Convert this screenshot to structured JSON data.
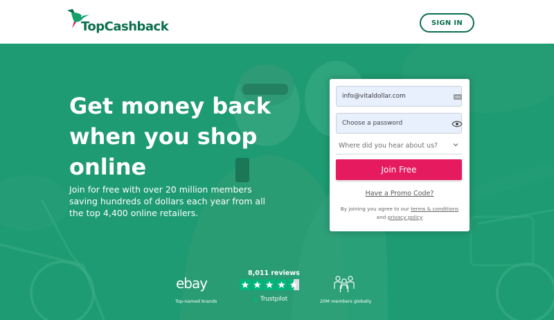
{
  "header": {
    "brand": "TopCashback",
    "signin_label": "SIGN IN"
  },
  "hero": {
    "headline": "Get money back when you shop online",
    "subtext": "Join for free with over 20 million members saving hundreds of dollars each year from all the top 4,400 online retailers."
  },
  "form": {
    "email_value": "info@vitaldollar.com",
    "password_placeholder": "Choose a password",
    "source_placeholder": "Where did you hear about us?",
    "join_label": "Join Free",
    "promo_label": "Have a Promo Code?",
    "terms_prefix": "By joining you agree to our ",
    "terms_link": "terms & conditions",
    "terms_and": " and ",
    "privacy_link": "privacy policy"
  },
  "trust": {
    "ebay_logo": "ebay",
    "ebay_caption": "Top-named brands",
    "reviews": "8,011 reviews",
    "trustpilot": "Trustpilot",
    "trustpilot_stars": 4.5,
    "members_caption": "20M members globally"
  },
  "colors": {
    "brand_green": "#0a6e4b",
    "hero_green": "#1e9b72",
    "join_pink": "#e61a5e",
    "trustpilot_green": "#00b67a"
  }
}
